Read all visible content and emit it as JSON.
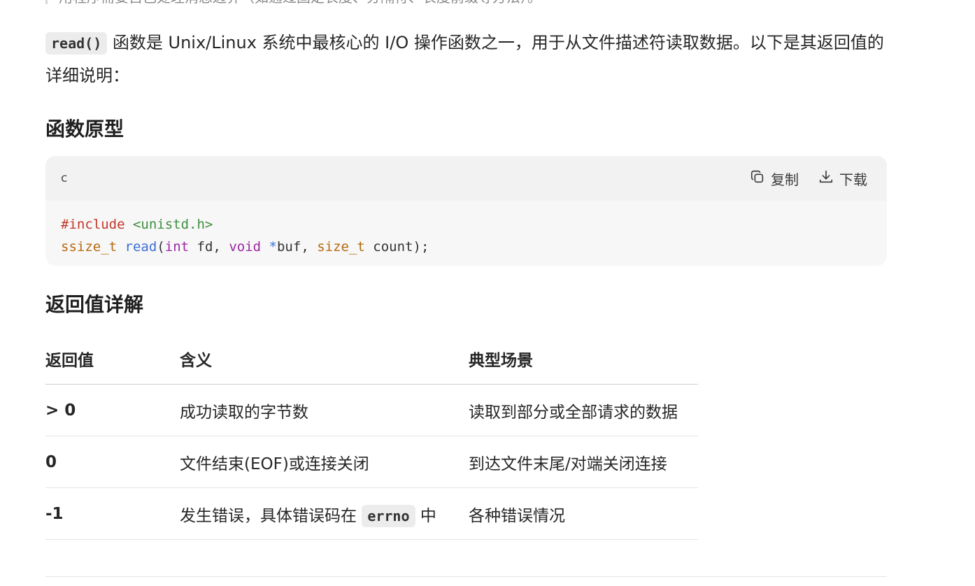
{
  "blockquote_text": "用程序需要自己处理消息边界（如通过固定长度、分隔符、长度前缀等方法）。",
  "intro": {
    "code": "read()",
    "text_1": " 函数是 Unix/Linux 系统中最核心的 I/O 操作函数之一，用于从文件描述符读取数据。以下是其返回值的详细说明："
  },
  "section_prototype": {
    "heading": "函数原型",
    "code_block": {
      "language": "c",
      "copy_label": "复制",
      "download_label": "下载",
      "lines": [
        "#include <unistd.h>",
        "ssize_t read(int fd, void *buf, size_t count);"
      ]
    }
  },
  "section_return": {
    "heading": "返回值详解",
    "table": {
      "headers": [
        "返回值",
        "含义",
        "典型场景"
      ],
      "rows": [
        {
          "value": "> 0",
          "meaning": "成功读取的字节数",
          "scenario": "读取到部分或全部请求的数据"
        },
        {
          "value": "0",
          "meaning": "文件结束(EOF)或连接关闭",
          "scenario": "到达文件末尾/对端关闭连接"
        },
        {
          "value": "-1",
          "meaning_pre": "发生错误，具体错误码在 ",
          "meaning_code": "errno",
          "meaning_post": " 中",
          "scenario": "各种错误情况"
        }
      ]
    }
  }
}
